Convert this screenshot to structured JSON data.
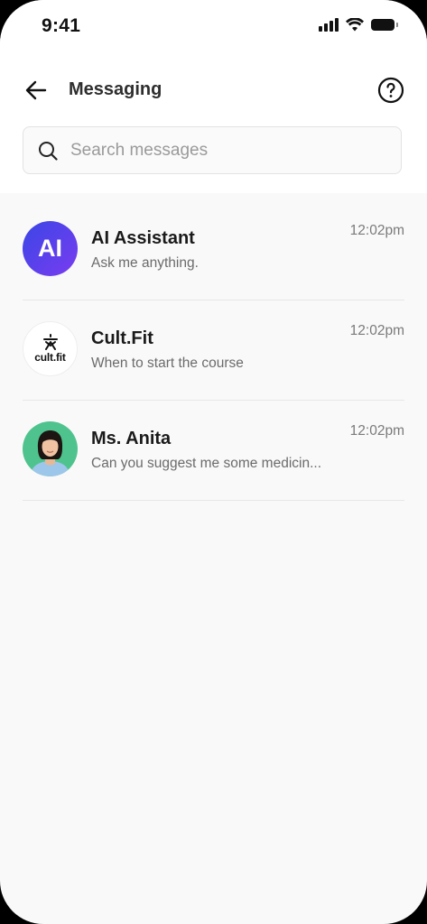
{
  "status": {
    "time": "9:41"
  },
  "header": {
    "title": "Messaging"
  },
  "search": {
    "placeholder": "Search messages",
    "value": ""
  },
  "conversations": [
    {
      "avatar_text": "AI",
      "name": "AI Assistant",
      "preview": "Ask me anything.",
      "time": "12:02pm"
    },
    {
      "avatar_text": "cult.fit",
      "name": "Cult.Fit",
      "preview": "When to start the course",
      "time": "12:02pm"
    },
    {
      "name": "Ms. Anita",
      "preview": "Can you suggest me some medicin...",
      "time": "12:02pm"
    }
  ],
  "colors": {
    "ai_gradient_start": "#3a46e6",
    "ai_gradient_end": "#7a3cf0",
    "anita_bg": "#4fc38e"
  }
}
